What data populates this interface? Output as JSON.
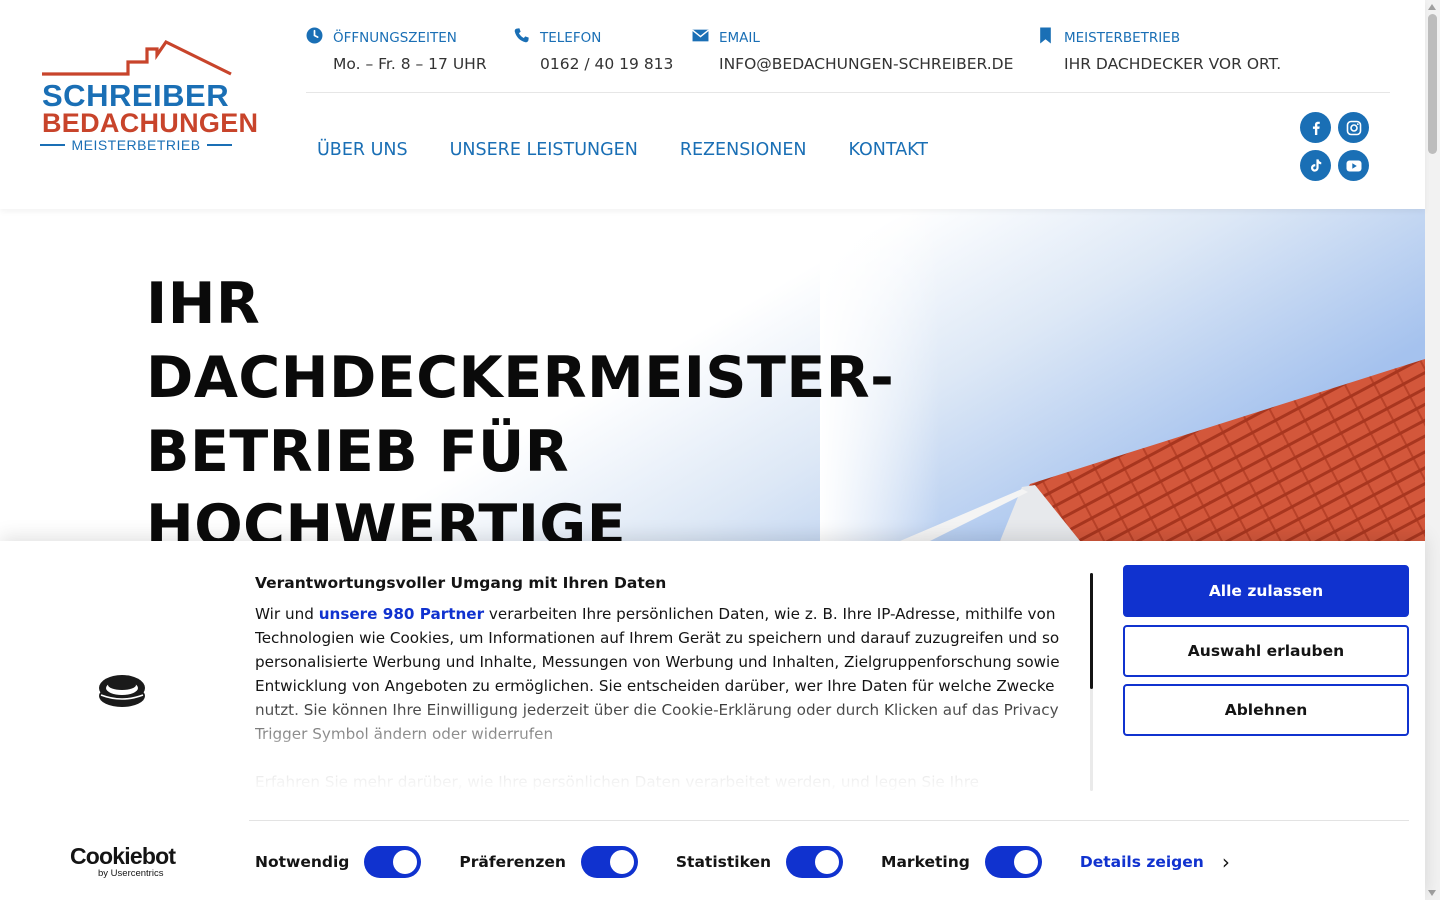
{
  "logo": {
    "line1": "SCHREIBER",
    "line2": "BEDACHUNGEN",
    "line3": "MEISTERBETRIEB",
    "colors": {
      "blue": "#1a6fb5",
      "red": "#c8442b"
    }
  },
  "info_bar": [
    {
      "icon": "clock-icon",
      "label": "ÖFFNUNGSZEITEN",
      "value": "Mo. – Fr. 8 – 17 UHR"
    },
    {
      "icon": "phone-icon",
      "label": "TELEFON",
      "value": "0162 / 40 19 813"
    },
    {
      "icon": "envelope-icon",
      "label": "EMAIL",
      "value": "INFO@BEDACHUNGEN-SCHREIBER.DE"
    },
    {
      "icon": "bookmark-icon",
      "label": "MEISTERBETRIEB",
      "value": "IHR DACHDECKER VOR ORT."
    }
  ],
  "nav": {
    "items": [
      "ÜBER UNS",
      "UNSERE LEISTUNGEN",
      "REZENSIONEN",
      "KONTAKT"
    ]
  },
  "social": [
    "facebook-icon",
    "instagram-icon",
    "tiktok-icon",
    "youtube-icon"
  ],
  "hero": {
    "title_lines": [
      "IHR",
      "DACHDECKERMEISTER-",
      "BETRIEB FÜR",
      "HOCHWERTIGE"
    ]
  },
  "cookie_banner": {
    "heading": "Verantwortungsvoller Umgang mit Ihren Daten",
    "text_before_link": "Wir und ",
    "link_text": "unsere 980 Partner",
    "text_after_link": " verarbeiten Ihre persönlichen Daten, wie z. B. Ihre IP-Adresse, mithilfe von Technologien wie Cookies, um Informationen auf Ihrem Gerät zu speichern und darauf zuzugreifen und so personalisierte Werbung und Inhalte, Messungen von Werbung und Inhalten, Zielgruppenforschung sowie Entwicklung von Angeboten zu ermöglichen. Sie entscheiden darüber, wer Ihre Daten für welche Zwecke nutzt. Sie können Ihre Einwilligung jederzeit über die Cookie-Erklärung oder durch Klicken auf das Privacy Trigger Symbol ändern oder widerrufen",
    "text_second": "Erfahren Sie mehr darüber, wie Ihre persönlichen Daten verarbeitet werden, und legen Sie Ihre",
    "buttons": {
      "allow_all": "Alle zulassen",
      "allow_selection": "Auswahl erlauben",
      "deny": "Ablehnen"
    },
    "brand": {
      "name": "Cookiebot",
      "sub": "by Usercentrics"
    },
    "toggles": [
      {
        "label": "Notwendig",
        "on": true
      },
      {
        "label": "Präferenzen",
        "on": true
      },
      {
        "label": "Statistiken",
        "on": true
      },
      {
        "label": "Marketing",
        "on": true
      }
    ],
    "details_label": "Details zeigen",
    "accent_color": "#1032cf"
  }
}
